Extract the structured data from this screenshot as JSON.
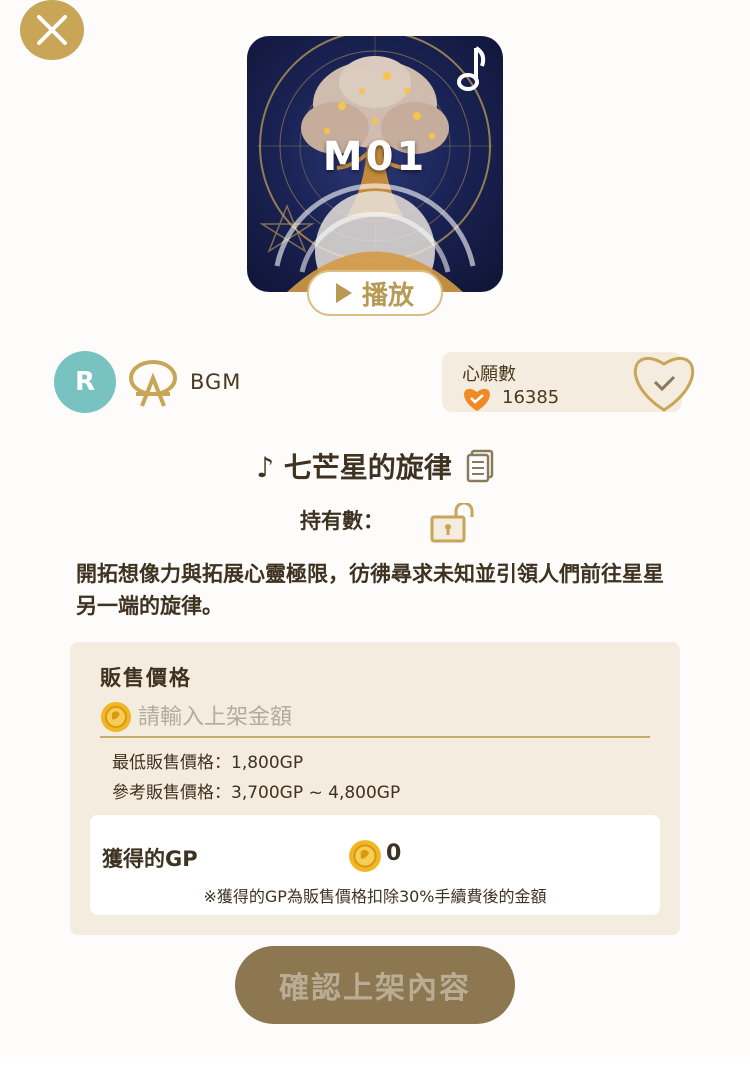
{
  "header": {
    "close_icon": "close-icon"
  },
  "artwork": {
    "code": "M01",
    "music_icon": "music-note-icon",
    "play_label": "播放"
  },
  "creator": {
    "avatar_letter": "R",
    "category": "BGM"
  },
  "wishes": {
    "label": "心願數",
    "count": "16385"
  },
  "item": {
    "title": "♪ 七芒星的旋律",
    "owned_label": "持有數：",
    "owned_value": "",
    "description": "開拓想像力與拓展心靈極限，彷彿尋求未知並引領人們前往星星另一端的旋律。"
  },
  "sale": {
    "title": "販售價格",
    "input_placeholder": "請輸入上架金額",
    "input_value": "",
    "min_price": "最低販售價格：1,800GP",
    "ref_price": "參考販售價格：3,700GP ~ 4,800GP",
    "gp_label": "獲得的GP",
    "gp_value": "0",
    "gp_note": "※獲得的GP為販售價格扣除30%手續費後的金額"
  },
  "actions": {
    "confirm_label": "確認上架內容"
  },
  "colors": {
    "accent_gold": "#c9a557",
    "panel_bg": "#f4ecdf",
    "avatar_teal": "#79c2c2",
    "confirm_bg": "#8d7750",
    "heart_orange": "#f08a24"
  }
}
